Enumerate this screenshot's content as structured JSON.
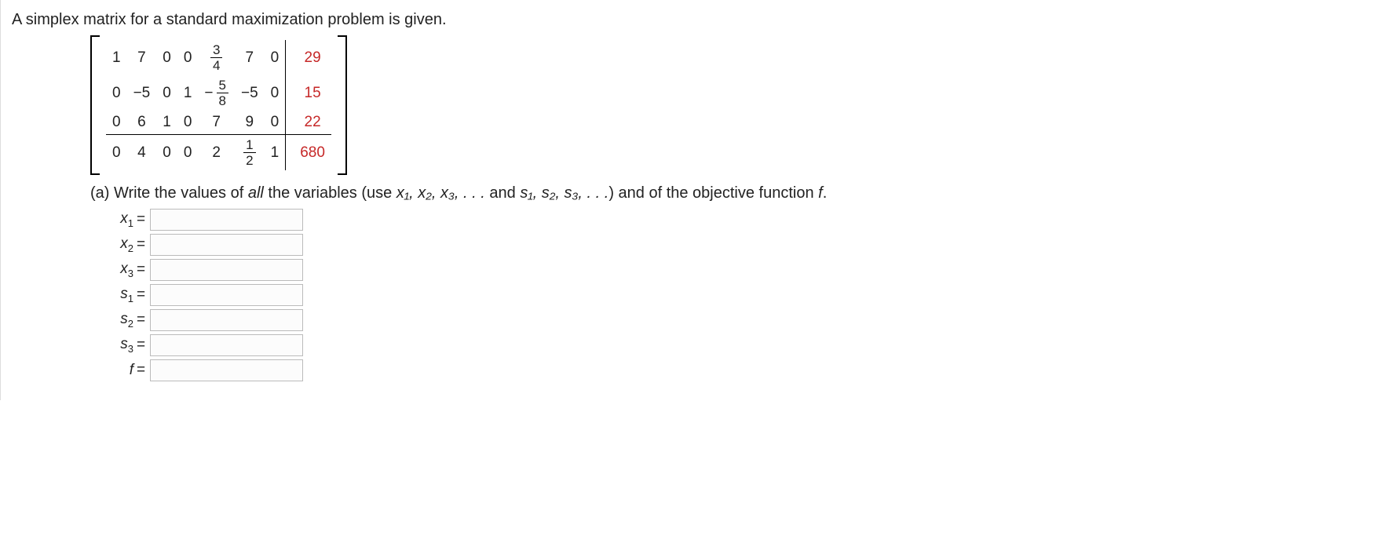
{
  "prompt": "A simplex matrix for a standard maximization problem is given.",
  "matrix": {
    "rows": [
      {
        "hrule": false,
        "cells": [
          "1",
          "7",
          "0",
          "0",
          "3/4",
          "7",
          "0",
          "29"
        ]
      },
      {
        "hrule": false,
        "cells": [
          "0",
          "−5",
          "0",
          "1",
          "−5/8",
          "−5",
          "0",
          "15"
        ]
      },
      {
        "hrule": true,
        "cells": [
          "0",
          "6",
          "1",
          "0",
          "7",
          "9",
          "0",
          "22"
        ]
      },
      {
        "hrule": false,
        "cells": [
          "0",
          "4",
          "0",
          "0",
          "2",
          "1/2",
          "1",
          "680"
        ]
      }
    ],
    "fractions": {
      "3/4": {
        "n": "3",
        "d": "4"
      },
      "5/8": {
        "n": "5",
        "d": "8"
      },
      "1/2": {
        "n": "1",
        "d": "2"
      }
    },
    "aug_col_index": 7,
    "red_cells": [
      [
        0,
        7
      ],
      [
        1,
        7
      ],
      [
        2,
        7
      ],
      [
        3,
        7
      ]
    ]
  },
  "part_a": {
    "label": "(a) Write the values of ",
    "all": "all",
    "mid1": " the variables (use  ",
    "varlist_x": "x₁, x₂, x₃, . . .",
    "mid2": "  and  ",
    "varlist_s": "s₁, s₂, s₃, . . .",
    "mid3": ") and of the objective function ",
    "fvar": "f",
    "end": "."
  },
  "answers": [
    {
      "label_main": "x",
      "label_sub": "1",
      "value": ""
    },
    {
      "label_main": "x",
      "label_sub": "2",
      "value": ""
    },
    {
      "label_main": "x",
      "label_sub": "3",
      "value": ""
    },
    {
      "label_main": "s",
      "label_sub": "1",
      "value": ""
    },
    {
      "label_main": "s",
      "label_sub": "2",
      "value": ""
    },
    {
      "label_main": "s",
      "label_sub": "3",
      "value": ""
    },
    {
      "label_main": "f",
      "label_sub": "",
      "value": ""
    }
  ]
}
